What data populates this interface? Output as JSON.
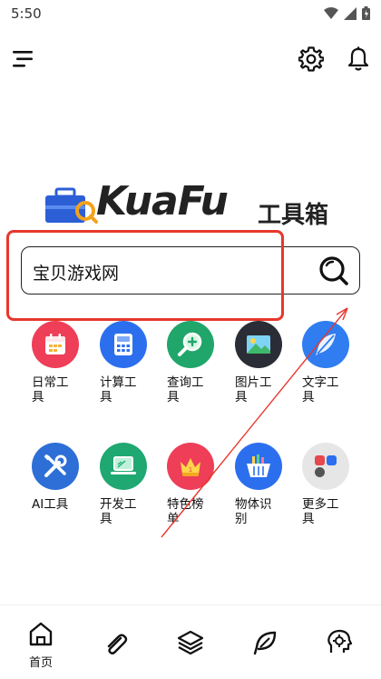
{
  "status_bar": {
    "time": "5:50",
    "icons": [
      "wifi-icon",
      "signal-icon",
      "battery-icon"
    ]
  },
  "header": {
    "icons": [
      "menu-icon",
      "gear-icon",
      "bell-icon"
    ]
  },
  "logo": {
    "word": "KuaFu",
    "cn": "工具箱"
  },
  "search": {
    "value": "宝贝游戏网",
    "icon": "search-icon"
  },
  "tools": [
    {
      "label": "日常工具",
      "icon": "calendar-icon",
      "color": "#ee3e58"
    },
    {
      "label": "计算工具",
      "icon": "calculator-icon",
      "color": "#2c6fee"
    },
    {
      "label": "查询工具",
      "icon": "magnifier-plus-icon",
      "color": "#20a66a"
    },
    {
      "label": "图片工具",
      "icon": "picture-icon",
      "color": "#2a2d35"
    },
    {
      "label": "文字工具",
      "icon": "feather-icon",
      "color": "#2f7df0"
    },
    {
      "label": "AI工具",
      "icon": "wrench-screwdriver-icon",
      "color": "#2d6fd6"
    },
    {
      "label": "开发工具",
      "icon": "laptop-icon",
      "color": "#1fa871"
    },
    {
      "label": "特色榜单",
      "icon": "crown-icon",
      "color": "#ee3e58"
    },
    {
      "label": "物体识别",
      "icon": "basket-icon",
      "color": "#2c6fee"
    },
    {
      "label": "更多工具",
      "icon": "more-apps-icon",
      "color": "#e6e6e6"
    }
  ],
  "bottom_nav": [
    {
      "label": "首页",
      "icon": "home-icon"
    },
    {
      "label": "",
      "icon": "paperclip-icon"
    },
    {
      "label": "",
      "icon": "layers-icon"
    },
    {
      "label": "",
      "icon": "leaf-icon"
    },
    {
      "label": "",
      "icon": "brain-gear-icon"
    }
  ],
  "colors": {
    "annotation": "#e8372c",
    "text": "#111111"
  }
}
